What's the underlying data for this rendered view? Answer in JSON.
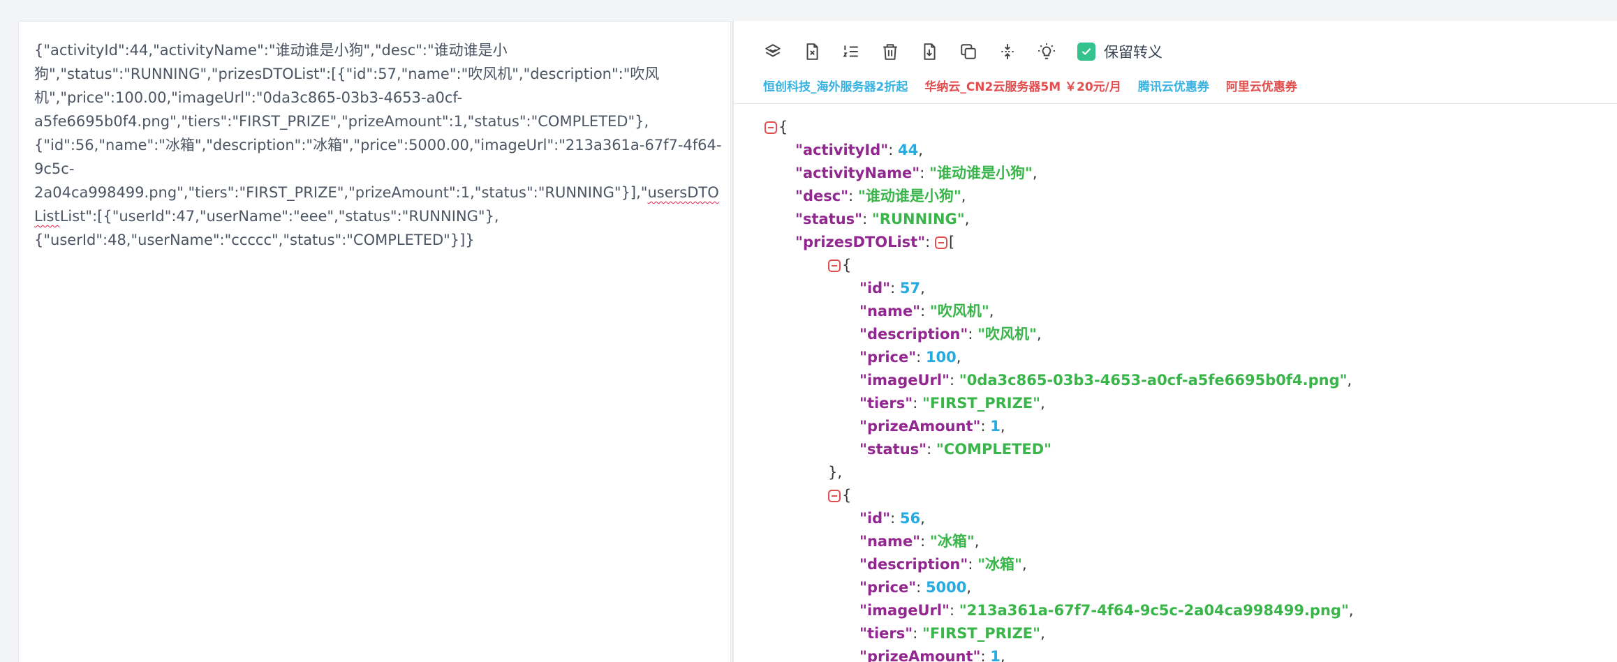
{
  "input": {
    "lines": [
      "{\"activityId\":44,\"activityName\":\"谁动谁是小狗\",\"desc\":\"谁动谁是小",
      "狗\",\"status\":\"RUNNING\",\"prizesDTOList\":[{\"id\":57,\"name\":\"吹风机\",\"description\":\"吹风",
      "机\",\"price\":100.00,\"imageUrl\":\"0da3c865-03b3-4653-a0cf-",
      "a5fe6695b0f4.png\",\"tiers\":\"FIRST_PRIZE\",\"prizeAmount\":1,\"status\":\"COMPLETED\"},",
      "{\"id\":56,\"name\":\"冰箱\",\"description\":\"冰箱\",\"price\":5000.00,\"imageUrl\":\"213a361a-67f7-4f64-",
      "9c5c-",
      "2a04ca998499.png\",\"tiers\":\"FIRST_PRIZE\",\"prizeAmount\":1,\"status\":\"RUNNING\"}],\"",
      "List\":[{\"userId\":47,\"userName\":\"eee\",\"status\":\"RUNNING\"},",
      "{\"userId\":48,\"userName\":\"ccccc\",\"status\":\"COMPLETED\"}]}"
    ],
    "line7_underlined": "usersDTO",
    "line8_underlined": "List"
  },
  "toolbar": {
    "icons": [
      "layers-icon",
      "clear-file-icon",
      "ordered-list-icon",
      "trash-icon",
      "download-icon",
      "copy-icon",
      "compress-icon",
      "lightbulb-icon"
    ],
    "checkbox_label": "保留转义",
    "checkbox_checked": true,
    "accent_color": "#34c38f"
  },
  "ads": [
    {
      "text": "恒创科技_海外服务器2折起",
      "color": "#38b2e0"
    },
    {
      "text": "华纳云_CN2云服务器5M ￥20元/月",
      "color": "#e24d4d"
    },
    {
      "text": "腾讯云优惠券",
      "color": "#38b2e0"
    },
    {
      "text": "阿里云优惠券",
      "color": "#e24d4d"
    }
  ],
  "json_view": {
    "colors": {
      "key": "#92278f",
      "string": "#3ab54a",
      "number": "#25aae1",
      "toggle": "#e24d4d"
    },
    "root": {
      "activityId": "44",
      "activityName": "\"谁动谁是小狗\"",
      "desc": "\"谁动谁是小狗\"",
      "status": "\"RUNNING\""
    },
    "prizes": [
      {
        "id": "57",
        "name": "\"吹风机\"",
        "description": "\"吹风机\"",
        "price": "100",
        "imageUrl": "\"0da3c865-03b3-4653-a0cf-a5fe6695b0f4.png\"",
        "tiers": "\"FIRST_PRIZE\"",
        "prizeAmount": "1",
        "status": "\"COMPLETED\""
      },
      {
        "id": "56",
        "name": "\"冰箱\"",
        "description": "\"冰箱\"",
        "price": "5000",
        "imageUrl": "\"213a361a-67f7-4f64-9c5c-2a04ca998499.png\"",
        "tiers": "\"FIRST_PRIZE\"",
        "prizeAmount": "1"
      }
    ],
    "keys": {
      "activityId": "\"activityId\"",
      "activityName": "\"activityName\"",
      "desc": "\"desc\"",
      "status": "\"status\"",
      "prizesDTOList": "\"prizesDTOList\"",
      "id": "\"id\"",
      "name": "\"name\"",
      "description": "\"description\"",
      "price": "\"price\"",
      "imageUrl": "\"imageUrl\"",
      "tiers": "\"tiers\"",
      "prizeAmount": "\"prizeAmount\""
    }
  }
}
